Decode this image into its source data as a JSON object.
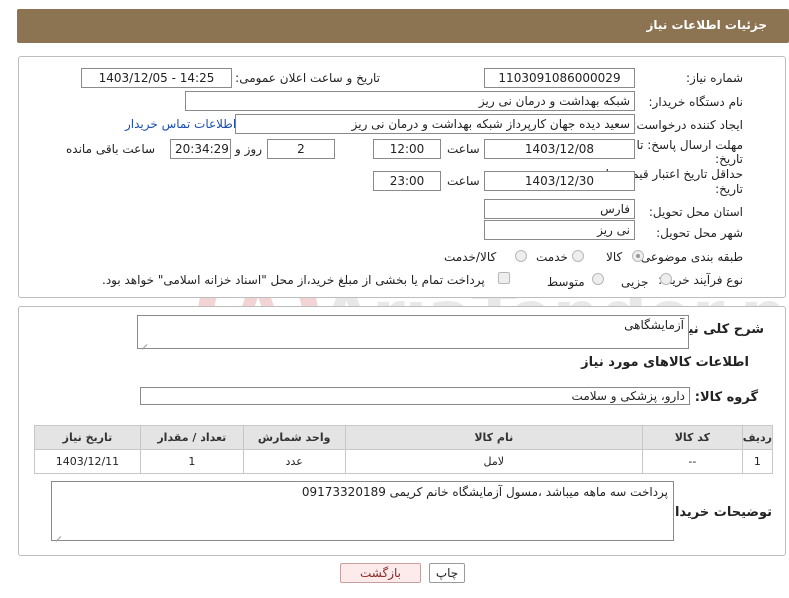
{
  "header": {
    "title": "جزئیات اطلاعات نیاز",
    "bg": "#8c7352"
  },
  "form": {
    "need_number_label": "شماره نیاز:",
    "need_number": "1103091086000029",
    "announce_label": "تاریخ و ساعت اعلان عمومی:",
    "announce_value": "1403/12/05 - 14:25",
    "buyer_org_label": "نام دستگاه خریدار:",
    "buyer_org": "شبکه بهداشت و درمان نی ریز",
    "creator_label": "ایجاد کننده درخواست:",
    "creator": "سعید دیده جهان کارپرداز شبکه بهداشت و درمان نی ریز",
    "contact_link": "اطلاعات تماس خریدار",
    "send_deadline_label_1": "مهلت ارسال پاسخ: تا",
    "send_deadline_label_2": "تاریخ:",
    "send_date": "1403/12/08",
    "time_label": "ساعت",
    "send_time": "12:00",
    "days_value": "2",
    "days_label": "روز و",
    "remaining_time": "20:34:29",
    "remaining_label": "ساعت باقی مانده",
    "price_deadline_label_1": "حداقل تاریخ اعتبار قیمت: تا",
    "price_deadline_label_2": "تاریخ:",
    "price_date": "1403/12/30",
    "price_time": "23:00",
    "province_label": "استان محل تحویل:",
    "province": "فارس",
    "city_label": "شهر محل تحویل:",
    "city": "نی ریز",
    "category_label": "طبقه بندی موضوعی:",
    "category_options": [
      "کالا",
      "خدمت",
      "کالا/خدمت"
    ],
    "process_label": "نوع فرآیند خرید :",
    "process_options": [
      "جزیی",
      "متوسط"
    ],
    "payment_note": "پرداخت تمام یا بخشی از مبلغ خرید،از محل \"اسناد خزانه اسلامی\" خواهد بود."
  },
  "details": {
    "desc_label": "شرح کلی نیاز:",
    "desc_value": "آزمایشگاهی",
    "goods_info_title": "اطلاعات کالاهای مورد نیاز",
    "group_label": "گروه کالا:",
    "group_value": "دارو، پزشکی و سلامت",
    "table": {
      "headers": [
        "ردیف",
        "کد کالا",
        "نام کالا",
        "واحد شمارش",
        "تعداد / مقدار",
        "تاریخ نیاز"
      ],
      "rows": [
        [
          "1",
          "--",
          "لامل",
          "عدد",
          "1",
          "1403/12/11"
        ]
      ]
    },
    "buyer_notes_label": "توضیحات خریدار:",
    "buyer_notes": "پرداخت سه ماهه میباشد ،مسول آزمایشگاه خانم کریمی 09173320189"
  },
  "buttons": {
    "print": "چاپ",
    "back": "بازگشت"
  },
  "watermark": "AriaTender.net"
}
